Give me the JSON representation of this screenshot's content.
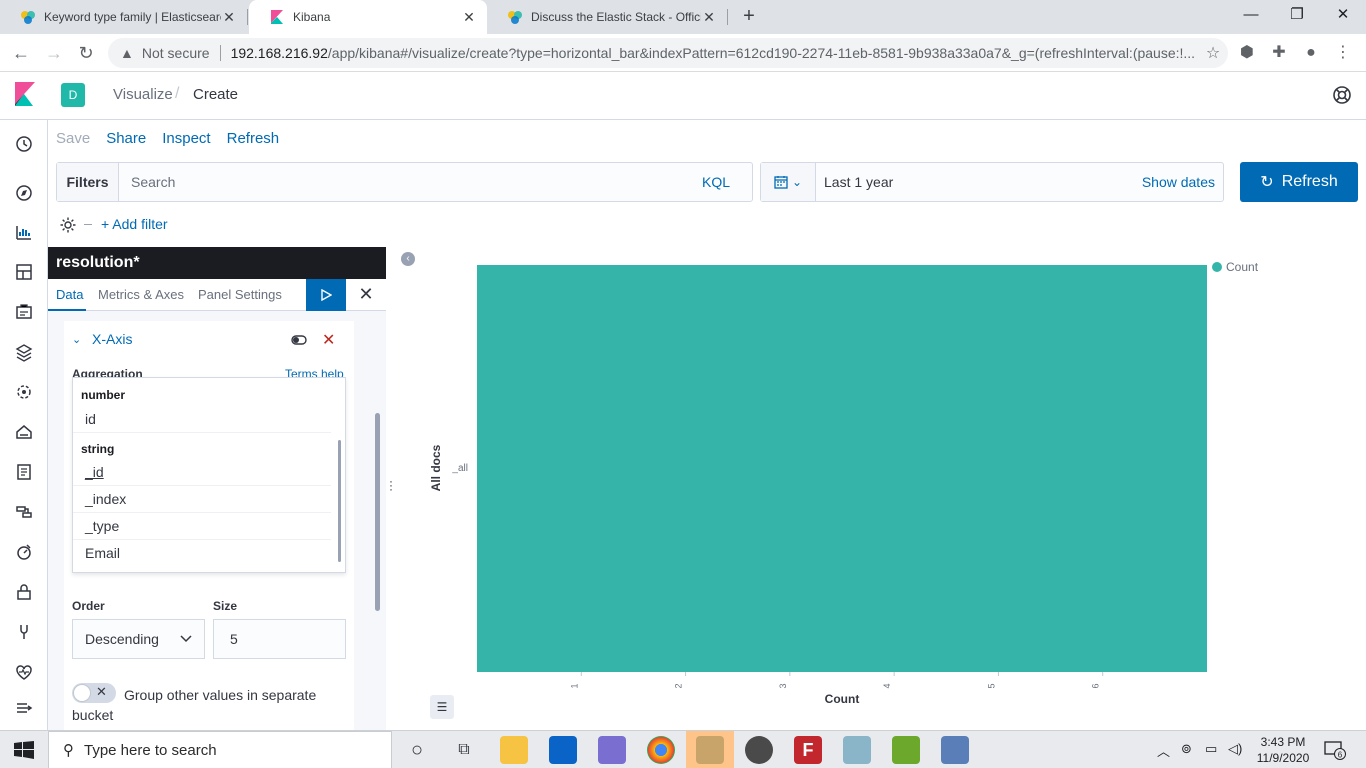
{
  "browser": {
    "tabs": [
      {
        "title": "Keyword type family | Elasticsearc",
        "active": false
      },
      {
        "title": "Kibana",
        "active": true
      },
      {
        "title": "Discuss the Elastic Stack - Official",
        "active": false
      }
    ],
    "not_secure": "Not secure",
    "url_host": "192.168.216.92",
    "url_path": "/app/kibana#/visualize/create?type=horizontal_bar&indexPattern=612cd190-2274-11eb-8581-9b938a33a0a7&_g=(refreshInterval:(pause:!..."
  },
  "kibana": {
    "space_initial": "D",
    "breadcrumb": [
      "Visualize",
      "Create"
    ],
    "menu": {
      "save": "Save",
      "share": "Share",
      "inspect": "Inspect",
      "refresh": "Refresh"
    },
    "query": {
      "filters_label": "Filters",
      "search_placeholder": "Search",
      "kql": "KQL"
    },
    "time": {
      "range": "Last 1 year",
      "show_dates": "Show dates"
    },
    "refresh_button": "Refresh",
    "add_filter": "+ Add filter"
  },
  "editor": {
    "title": "resolution*",
    "tabs": [
      "Data",
      "Metrics & Axes",
      "Panel Settings"
    ],
    "bucket": {
      "label": "X-Axis",
      "aggregation_label": "Aggregation",
      "help_link": "Terms help"
    },
    "field_dropdown": {
      "groups": [
        {
          "label": "number",
          "options": [
            "id"
          ]
        },
        {
          "label": "string",
          "options": [
            "_id",
            "_index",
            "_type",
            "Email"
          ]
        }
      ]
    },
    "order": {
      "label": "Order",
      "value": "Descending"
    },
    "size": {
      "label": "Size",
      "value": "5"
    },
    "group_other_label": "Group other values in separate bucket"
  },
  "chart_data": {
    "type": "bar",
    "orientation": "horizontal",
    "categories": [
      "_all"
    ],
    "series": [
      {
        "name": "Count",
        "values": [
          7
        ],
        "color": "#35b5aa"
      }
    ],
    "xlabel": "Count",
    "ylabel": "All docs",
    "x_ticks": [
      "1",
      "2",
      "3",
      "4",
      "5",
      "6"
    ],
    "xlim": [
      0,
      7
    ],
    "legend": "top-right",
    "grid": false
  },
  "taskbar": {
    "search_placeholder": "Type here to search",
    "time": "3:43 PM",
    "date": "11/9/2020",
    "notifications": "6"
  },
  "colors": {
    "accent": "#006bb4",
    "bar": "#35b5aa",
    "editor_header": "#1a1c21"
  }
}
